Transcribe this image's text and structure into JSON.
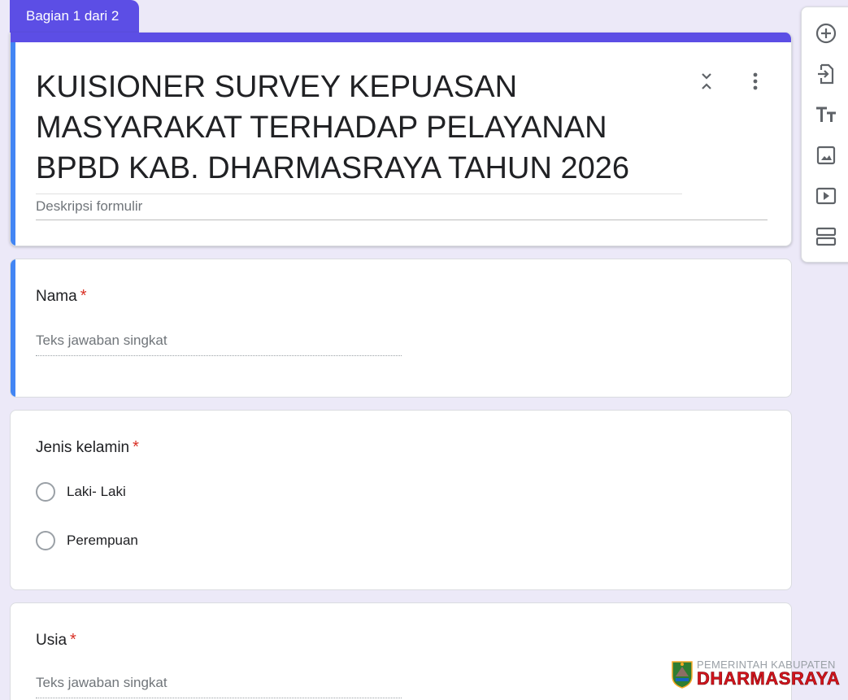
{
  "section": {
    "label": "Bagian 1 dari 2"
  },
  "form": {
    "title": "KUISIONER SURVEY KEPUASAN MASYARAKAT TERHADAP PELAYANAN BPBD KAB. DHARMASRAYA TAHUN 2026",
    "description_placeholder": "Deskripsi formulir"
  },
  "questions": [
    {
      "title": "Nama",
      "required_mark": "*",
      "type": "short",
      "placeholder": "Teks jawaban singkat"
    },
    {
      "title": "Jenis kelamin",
      "required_mark": "*",
      "type": "radio",
      "options": [
        "Laki- Laki",
        "Perempuan"
      ]
    },
    {
      "title": "Usia",
      "required_mark": "*",
      "type": "short",
      "placeholder": "Teks jawaban singkat"
    }
  ],
  "toolbar": {
    "icons": [
      "add-question-icon",
      "import-question-icon",
      "add-title-icon",
      "add-image-icon",
      "add-video-icon",
      "add-section-icon"
    ]
  },
  "logo": {
    "line1": "PEMERINTAH KABUPATEN",
    "line2": "DHARMASRAYA"
  },
  "colors": {
    "accent": "#5c4ee5",
    "active_border": "#4285f4",
    "required": "#d93025",
    "background": "#ece9f8"
  }
}
